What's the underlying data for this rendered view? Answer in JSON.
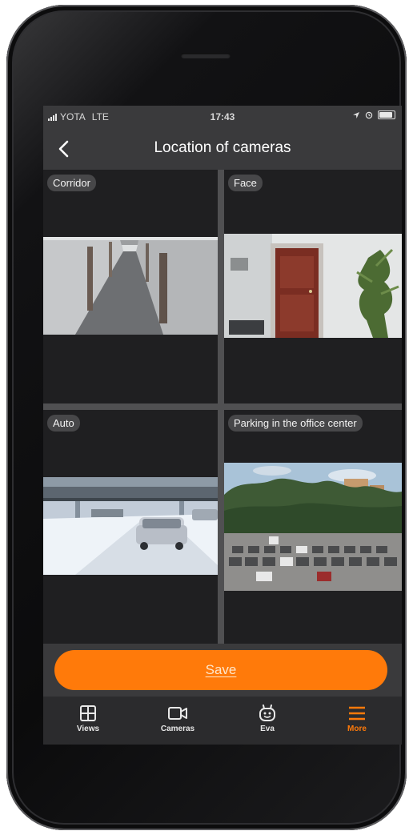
{
  "status_bar": {
    "carrier": "YOTA",
    "network": "LTE",
    "time": "17:43"
  },
  "header": {
    "title": "Location of cameras",
    "back_icon": "chevron-left-icon"
  },
  "cameras": [
    {
      "label": "Corridor"
    },
    {
      "label": "Face"
    },
    {
      "label": "Auto"
    },
    {
      "label": "Parking in the office center"
    }
  ],
  "actions": {
    "save_label": "Save"
  },
  "tabs": [
    {
      "label": "Views",
      "icon": "grid-icon",
      "active": false
    },
    {
      "label": "Cameras",
      "icon": "video-camera-icon",
      "active": false
    },
    {
      "label": "Eva",
      "icon": "robot-icon",
      "active": false
    },
    {
      "label": "More",
      "icon": "menu-icon",
      "active": true
    }
  ],
  "colors": {
    "accent": "#ff7a0a",
    "bar_background": "#3a3a3c",
    "screen_background": "#1f1f21"
  }
}
